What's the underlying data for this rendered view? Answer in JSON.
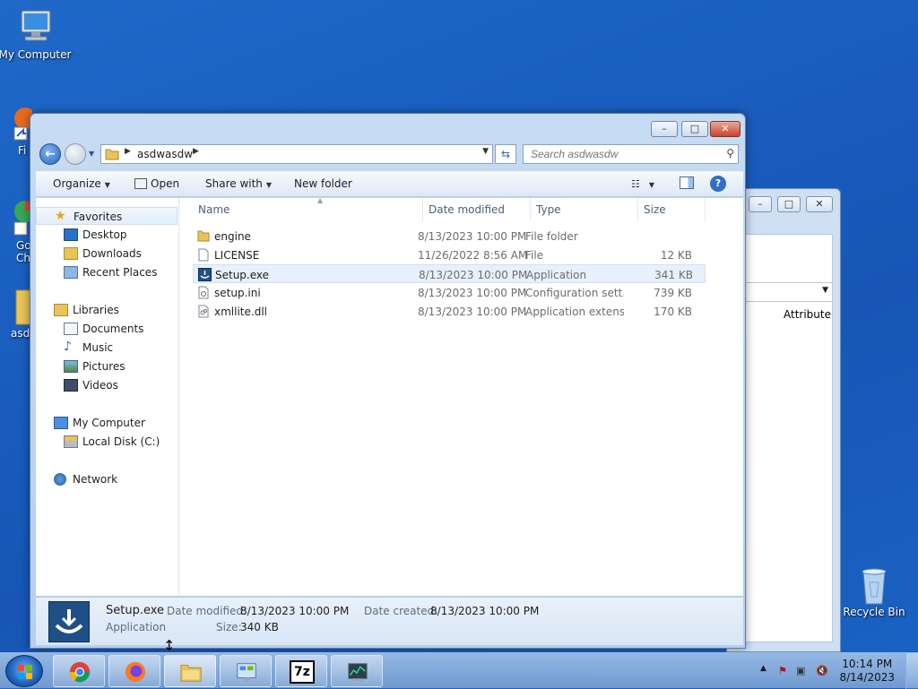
{
  "desktop": {
    "icons": [
      {
        "label": "My Computer",
        "icon": "computer-icon"
      },
      {
        "label": "Recycle Bin",
        "icon": "recycle-bin-icon"
      }
    ],
    "partial_labels": [
      "Fi",
      "Go",
      "Ch",
      "asd"
    ]
  },
  "window": {
    "controls": {
      "minimize": "–",
      "maximize": "□",
      "close": "✕"
    },
    "address": {
      "crumb": "asdwasdw"
    },
    "search": {
      "placeholder": "Search asdwasdw"
    },
    "toolbar": {
      "organize": "Organize",
      "open": "Open",
      "share_with": "Share with",
      "new_folder": "New folder"
    },
    "nav": {
      "favorites": "Favorites",
      "desktop": "Desktop",
      "downloads": "Downloads",
      "recent_places": "Recent Places",
      "libraries": "Libraries",
      "documents": "Documents",
      "music": "Music",
      "pictures": "Pictures",
      "videos": "Videos",
      "my_computer": "My Computer",
      "local_disk": "Local Disk (C:)",
      "network": "Network"
    },
    "columns": {
      "name": "Name",
      "date_modified": "Date modified",
      "type": "Type",
      "size": "Size"
    },
    "files": [
      {
        "name": "engine",
        "date": "8/13/2023 10:00 PM",
        "type": "File folder",
        "size": "",
        "icon": "folder-icon"
      },
      {
        "name": "LICENSE",
        "date": "11/26/2022 8:56 AM",
        "type": "File",
        "size": "12 KB",
        "icon": "file-icon"
      },
      {
        "name": "Setup.exe",
        "date": "8/13/2023 10:00 PM",
        "type": "Application",
        "size": "341 KB",
        "icon": "setup-app-icon"
      },
      {
        "name": "setup.ini",
        "date": "8/13/2023 10:00 PM",
        "type": "Configuration sett...",
        "size": "739 KB",
        "icon": "settings-file-icon"
      },
      {
        "name": "xmllite.dll",
        "date": "8/13/2023 10:00 PM",
        "type": "Application extens...",
        "size": "170 KB",
        "icon": "dll-file-icon"
      }
    ],
    "details": {
      "name": "Setup.exe",
      "type": "Application",
      "date_modified_label": "Date modified:",
      "date_modified": "8/13/2023 10:00 PM",
      "date_created_label": "Date created:",
      "date_created": "8/13/2023 10:00 PM",
      "size_label": "Size:",
      "size": "340 KB"
    }
  },
  "background_window": {
    "column_header": "Attribute"
  },
  "taskbar": {
    "apps": [
      "chrome-icon",
      "firefox-icon",
      "explorer-icon",
      "control-panel-icon",
      "7zip-icon",
      "task-manager-icon"
    ],
    "sevenzip_label": "7z",
    "clock": {
      "time": "10:14 PM",
      "date": "8/14/2023"
    }
  },
  "colors": {
    "accent": "#1f69c9",
    "selection": "#e8f1fb"
  }
}
